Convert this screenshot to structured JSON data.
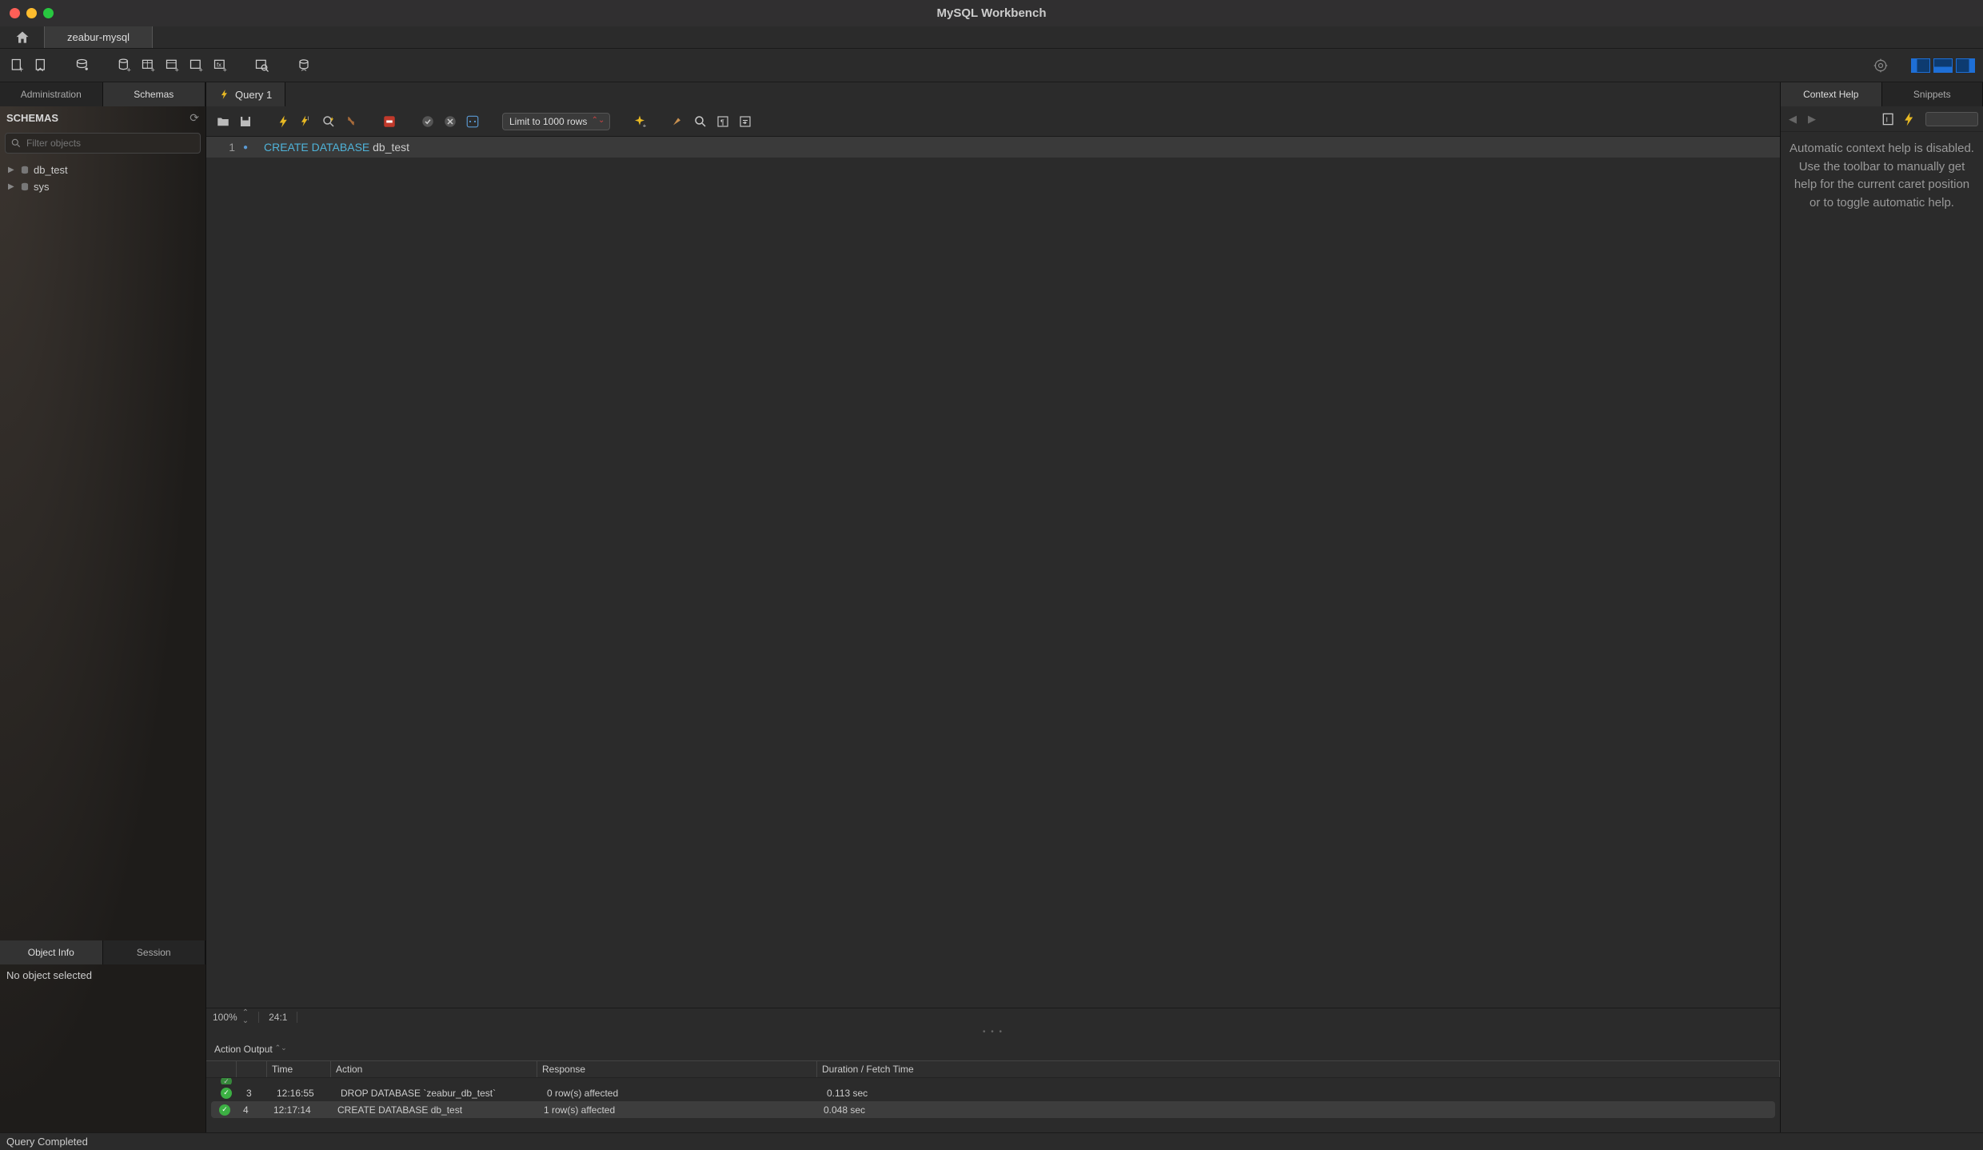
{
  "window": {
    "title": "MySQL Workbench"
  },
  "connTabs": {
    "connection": "zeabur-mysql"
  },
  "sidebar": {
    "tabs": {
      "admin": "Administration",
      "schemas": "Schemas"
    },
    "header": "SCHEMAS",
    "filter_placeholder": "Filter objects",
    "items": [
      {
        "name": "db_test"
      },
      {
        "name": "sys"
      }
    ],
    "bottom_tabs": {
      "object_info": "Object Info",
      "session": "Session"
    },
    "object_info_text": "No object selected"
  },
  "queryTabs": {
    "0": {
      "label": "Query 1"
    }
  },
  "editorToolbar": {
    "limit_label": "Limit to 1000 rows"
  },
  "editor": {
    "line1_num": "1",
    "line1_kw": "CREATE DATABASE",
    "line1_rest": " db_test"
  },
  "editorFooter": {
    "zoom": "100%",
    "pos": "24:1"
  },
  "output": {
    "selector_label": "Action Output",
    "headers": {
      "time": "Time",
      "action": "Action",
      "response": "Response",
      "duration": "Duration / Fetch Time"
    },
    "rows": [
      {
        "idx": "3",
        "time": "12:16:55",
        "action": "DROP DATABASE `zeabur_db_test`",
        "response": "0 row(s) affected",
        "duration": "0.113 sec",
        "selected": false
      },
      {
        "idx": "4",
        "time": "12:17:14",
        "action": "CREATE DATABASE db_test",
        "response": "1 row(s) affected",
        "duration": "0.048 sec",
        "selected": true
      }
    ]
  },
  "rightPanel": {
    "tabs": {
      "help": "Context Help",
      "snippets": "Snippets"
    },
    "help_text": "Automatic context help is disabled. Use the toolbar to manually get help for the current caret position or to toggle automatic help."
  },
  "statusBar": {
    "text": "Query Completed"
  }
}
